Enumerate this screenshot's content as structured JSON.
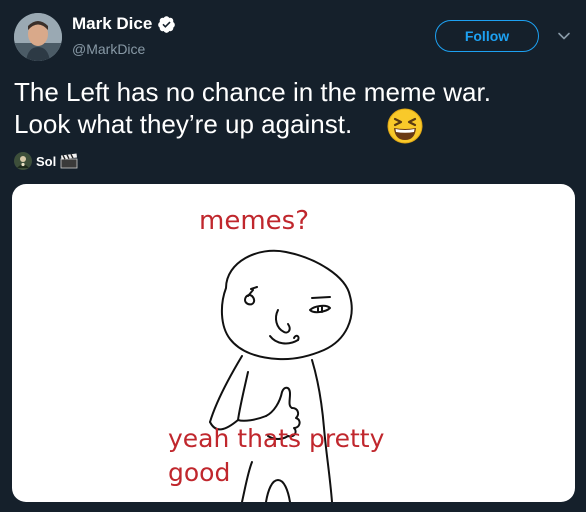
{
  "author": {
    "display_name": "Mark Dice",
    "handle": "@MarkDice",
    "verified": true,
    "avatar_icon": "profile-photo-icon",
    "verified_icon": "verified-badge-icon"
  },
  "actions": {
    "follow_label": "Follow",
    "menu_icon": "chevron-down-icon"
  },
  "tweet": {
    "text_line_1": "The Left has no chance in the meme war.",
    "text_line_2": "Look what they’re up against.",
    "emoji": "grinning-squinting-face-icon"
  },
  "tagged": {
    "name": "Sol",
    "avatar_icon": "tagged-user-avatar-icon",
    "emoji": "clapper-board-icon"
  },
  "media": {
    "top_caption": "memes?",
    "bottom_caption_line_1": "yeah thats pretty",
    "bottom_caption_line_2": "good"
  },
  "colors": {
    "background": "#15202b",
    "text_primary": "#ffffff",
    "text_secondary": "#8899a6",
    "accent": "#1da1f2",
    "meme_caption": "#c0272d"
  }
}
